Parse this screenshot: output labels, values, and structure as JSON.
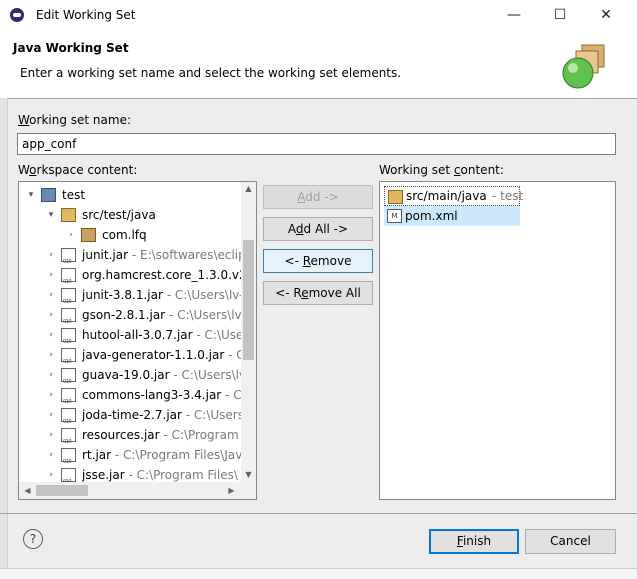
{
  "window": {
    "title": "Edit Working Set",
    "minimize_glyph": "—",
    "maximize_glyph": "☐",
    "close_glyph": "✕"
  },
  "header": {
    "title": "Java Working Set",
    "description": "Enter a working set name and select the working set elements."
  },
  "name_field": {
    "label_mnemonic": "W",
    "label_rest": "orking set name:",
    "value": "app_conf"
  },
  "workspace": {
    "label_pre": "W",
    "label_mnemonic": "o",
    "label_rest": "rkspace content:",
    "nodes": [
      {
        "label": "test",
        "decoration": "",
        "icon": "project",
        "twisty": "expanded"
      },
      {
        "label": "src/test/java",
        "decoration": "",
        "icon": "package-root",
        "twisty": "expanded"
      },
      {
        "label": "com.lfq",
        "decoration": "",
        "icon": "package",
        "twisty": "collapsed"
      },
      {
        "label": "junit.jar",
        "decoration": " - E:\\softwares\\eclip",
        "icon": "jar",
        "twisty": "collapsed"
      },
      {
        "label": "org.hamcrest.core_1.3.0.v20",
        "decoration": "",
        "icon": "jar",
        "twisty": "collapsed"
      },
      {
        "label": "junit-3.8.1.jar",
        "decoration": " - C:\\Users\\lv-",
        "icon": "jar",
        "twisty": "collapsed"
      },
      {
        "label": "gson-2.8.1.jar",
        "decoration": " - C:\\Users\\lv",
        "icon": "jar",
        "twisty": "collapsed"
      },
      {
        "label": "hutool-all-3.0.7.jar",
        "decoration": " - C:\\Use",
        "icon": "jar",
        "twisty": "collapsed"
      },
      {
        "label": "java-generator-1.1.0.jar",
        "decoration": " - C",
        "icon": "jar",
        "twisty": "collapsed"
      },
      {
        "label": "guava-19.0.jar",
        "decoration": " - C:\\Users\\lv",
        "icon": "jar",
        "twisty": "collapsed"
      },
      {
        "label": "commons-lang3-3.4.jar",
        "decoration": " - C:",
        "icon": "jar",
        "twisty": "collapsed"
      },
      {
        "label": "joda-time-2.7.jar",
        "decoration": " - C:\\Users",
        "icon": "jar",
        "twisty": "collapsed"
      },
      {
        "label": "resources.jar",
        "decoration": " - C:\\Program",
        "icon": "jar",
        "twisty": "collapsed"
      },
      {
        "label": "rt.jar",
        "decoration": " - C:\\Program Files\\Jav",
        "icon": "jar",
        "twisty": "collapsed"
      },
      {
        "label": "jsse.jar",
        "decoration": " - C:\\Program Files\\",
        "icon": "jar",
        "twisty": "collapsed"
      }
    ]
  },
  "buttons": {
    "add": {
      "mnemonic": "A",
      "rest": "dd ->"
    },
    "add_all": {
      "pre": "A",
      "mnemonic": "d",
      "rest": "d All ->"
    },
    "remove": {
      "pre": "<- ",
      "mnemonic": "R",
      "rest": "emove"
    },
    "remove_all": {
      "pre": "<- R",
      "mnemonic": "e",
      "rest": "move All"
    }
  },
  "working_set": {
    "label_pre": "Working set ",
    "label_mnemonic": "c",
    "label_rest": "ontent:",
    "items": [
      {
        "label": "src/main/java",
        "decoration": " - test",
        "icon": "package-root"
      },
      {
        "label": "pom.xml",
        "decoration": "",
        "icon": "file"
      }
    ]
  },
  "footer": {
    "help_glyph": "?",
    "finish": {
      "mnemonic": "F",
      "rest": "inish"
    },
    "cancel": "Cancel"
  },
  "colors": {
    "selection": "#cce8ff",
    "default_button_border": "#0078d7",
    "decoration_text": "#7a7a7a"
  }
}
